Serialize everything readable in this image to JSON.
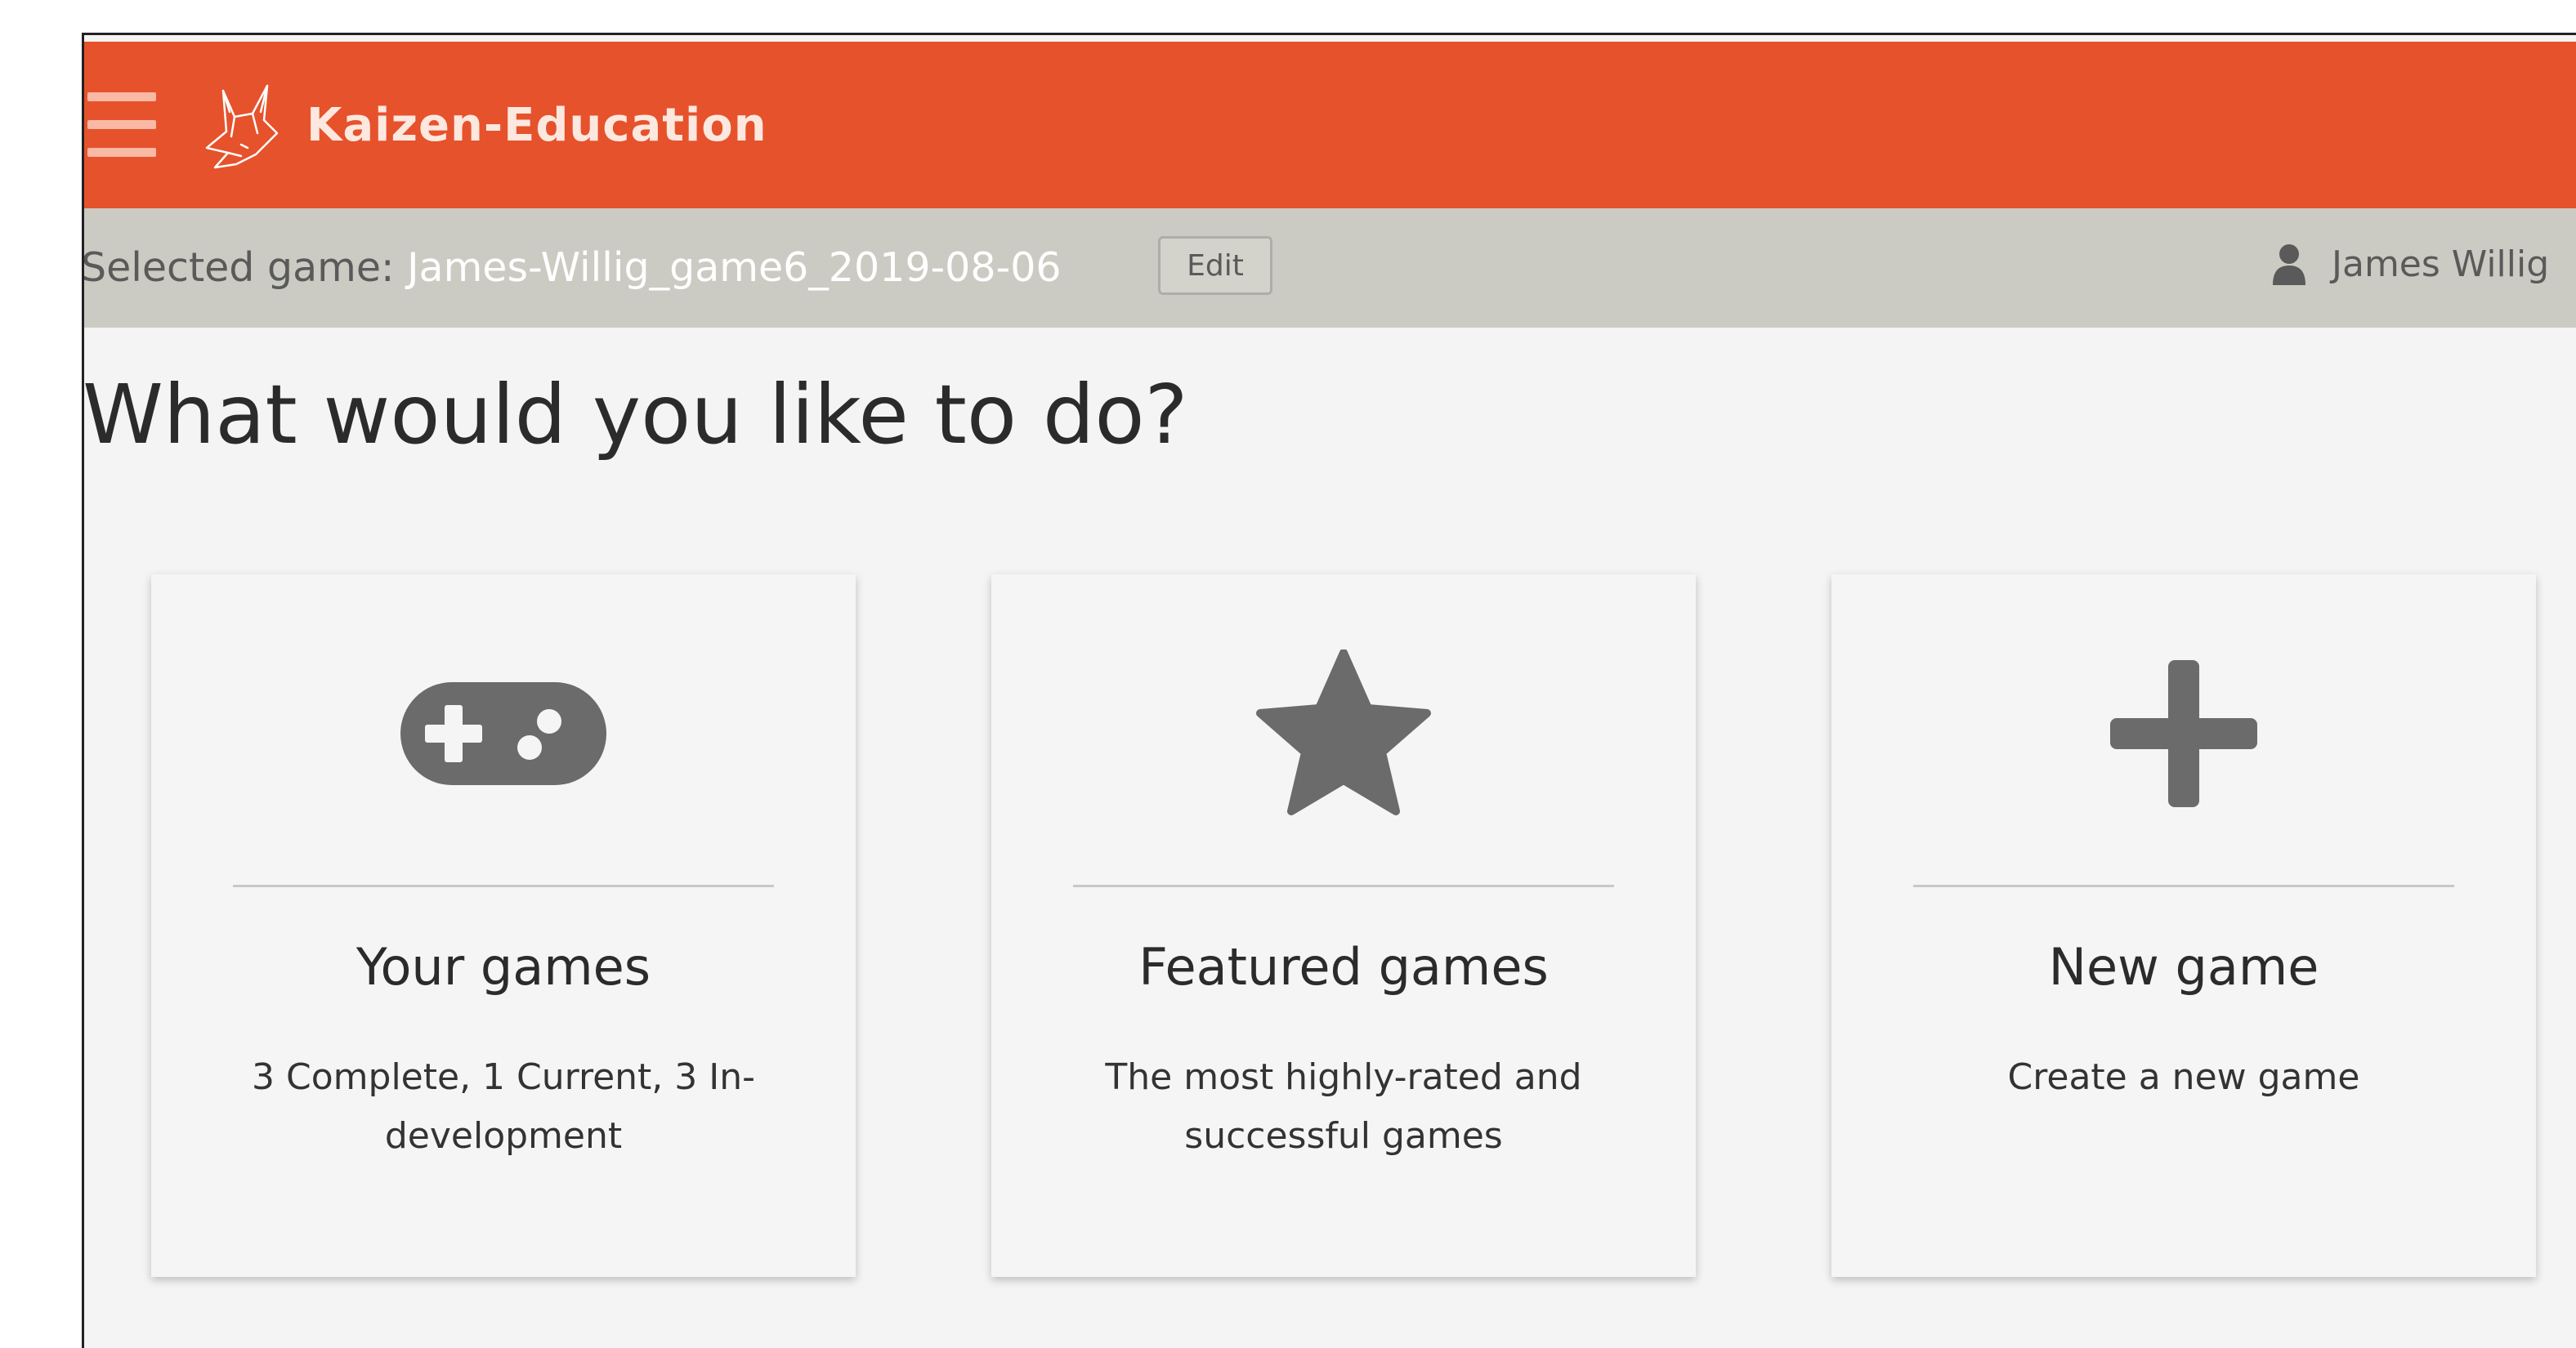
{
  "header": {
    "brand": "Kaizen-Education",
    "brand_color": "#e6522c"
  },
  "subbar": {
    "selected_label": "Selected game:",
    "selected_game": "James-Willig_game6_2019-08-06",
    "edit_label": "Edit",
    "user_name": "James Willig"
  },
  "main": {
    "heading": "What would you like to do?",
    "cards": [
      {
        "icon": "gamepad-icon",
        "title": "Your games",
        "description": "3 Complete, 1 Current, 3 In-development"
      },
      {
        "icon": "star-icon",
        "title": "Featured games",
        "description": "The most highly-rated and successful games"
      },
      {
        "icon": "plus-icon",
        "title": "New game",
        "description": "Create a new game"
      }
    ]
  }
}
